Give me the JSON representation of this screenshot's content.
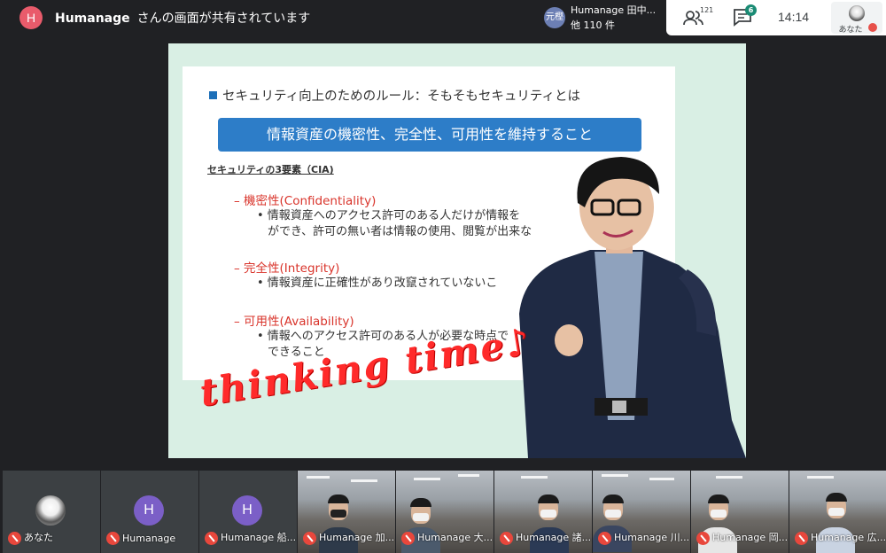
{
  "topbar": {
    "presenter_initial": "H",
    "presenter_name": "Humanage",
    "share_message": "さんの画面が共有されています",
    "speaker_initials": "元樫",
    "speaker_name": "Humanage 田中...",
    "speaker_others": "他 110 件",
    "participants_count": "121",
    "chat_badge": "6",
    "clock": "14:14",
    "self_label": "あなた"
  },
  "slide": {
    "title": "セキュリティ向上のためのルール：そもそもセキュリティとは",
    "banner": "情報資産の機密性、完全性、可用性を維持すること",
    "cia_heading": "セキュリティの3要素（CIA)",
    "items": [
      {
        "title": "– 機密性(Confidentiality)",
        "desc_line1": "• 情報資産へのアクセス許可のある人だけが情報を",
        "desc_line2": "ができ、許可の無い者は情報の使用、閲覧が出来な"
      },
      {
        "title": "– 完全性(Integrity)",
        "desc_line1": "• 情報資産に正確性があり改竄されていないこ",
        "desc_line2": ""
      },
      {
        "title": "– 可用性(Availability)",
        "desc_line1": "• 情報へのアクセス許可のある人が必要な時点で",
        "desc_line2": "できること"
      }
    ],
    "overlay_text": "thinking time♪"
  },
  "participants": [
    {
      "name": "あなた",
      "type": "self"
    },
    {
      "name": "Humanage",
      "type": "initial",
      "initial": "H"
    },
    {
      "name": "Humanage 船...",
      "type": "initial",
      "initial": "H"
    },
    {
      "name": "Humanage 加...",
      "type": "video"
    },
    {
      "name": "Humanage 大...",
      "type": "video"
    },
    {
      "name": "Humanage 諸...",
      "type": "video"
    },
    {
      "name": "Humanage 川...",
      "type": "video"
    },
    {
      "name": "Humanage 岡...",
      "type": "video"
    },
    {
      "name": "Humanage 広...",
      "type": "video"
    }
  ],
  "colors": {
    "accent_red": "#e8473c",
    "banner_blue": "#2d7dc8",
    "stage_green": "#d9efe4",
    "chat_badge": "#1a8b74"
  }
}
